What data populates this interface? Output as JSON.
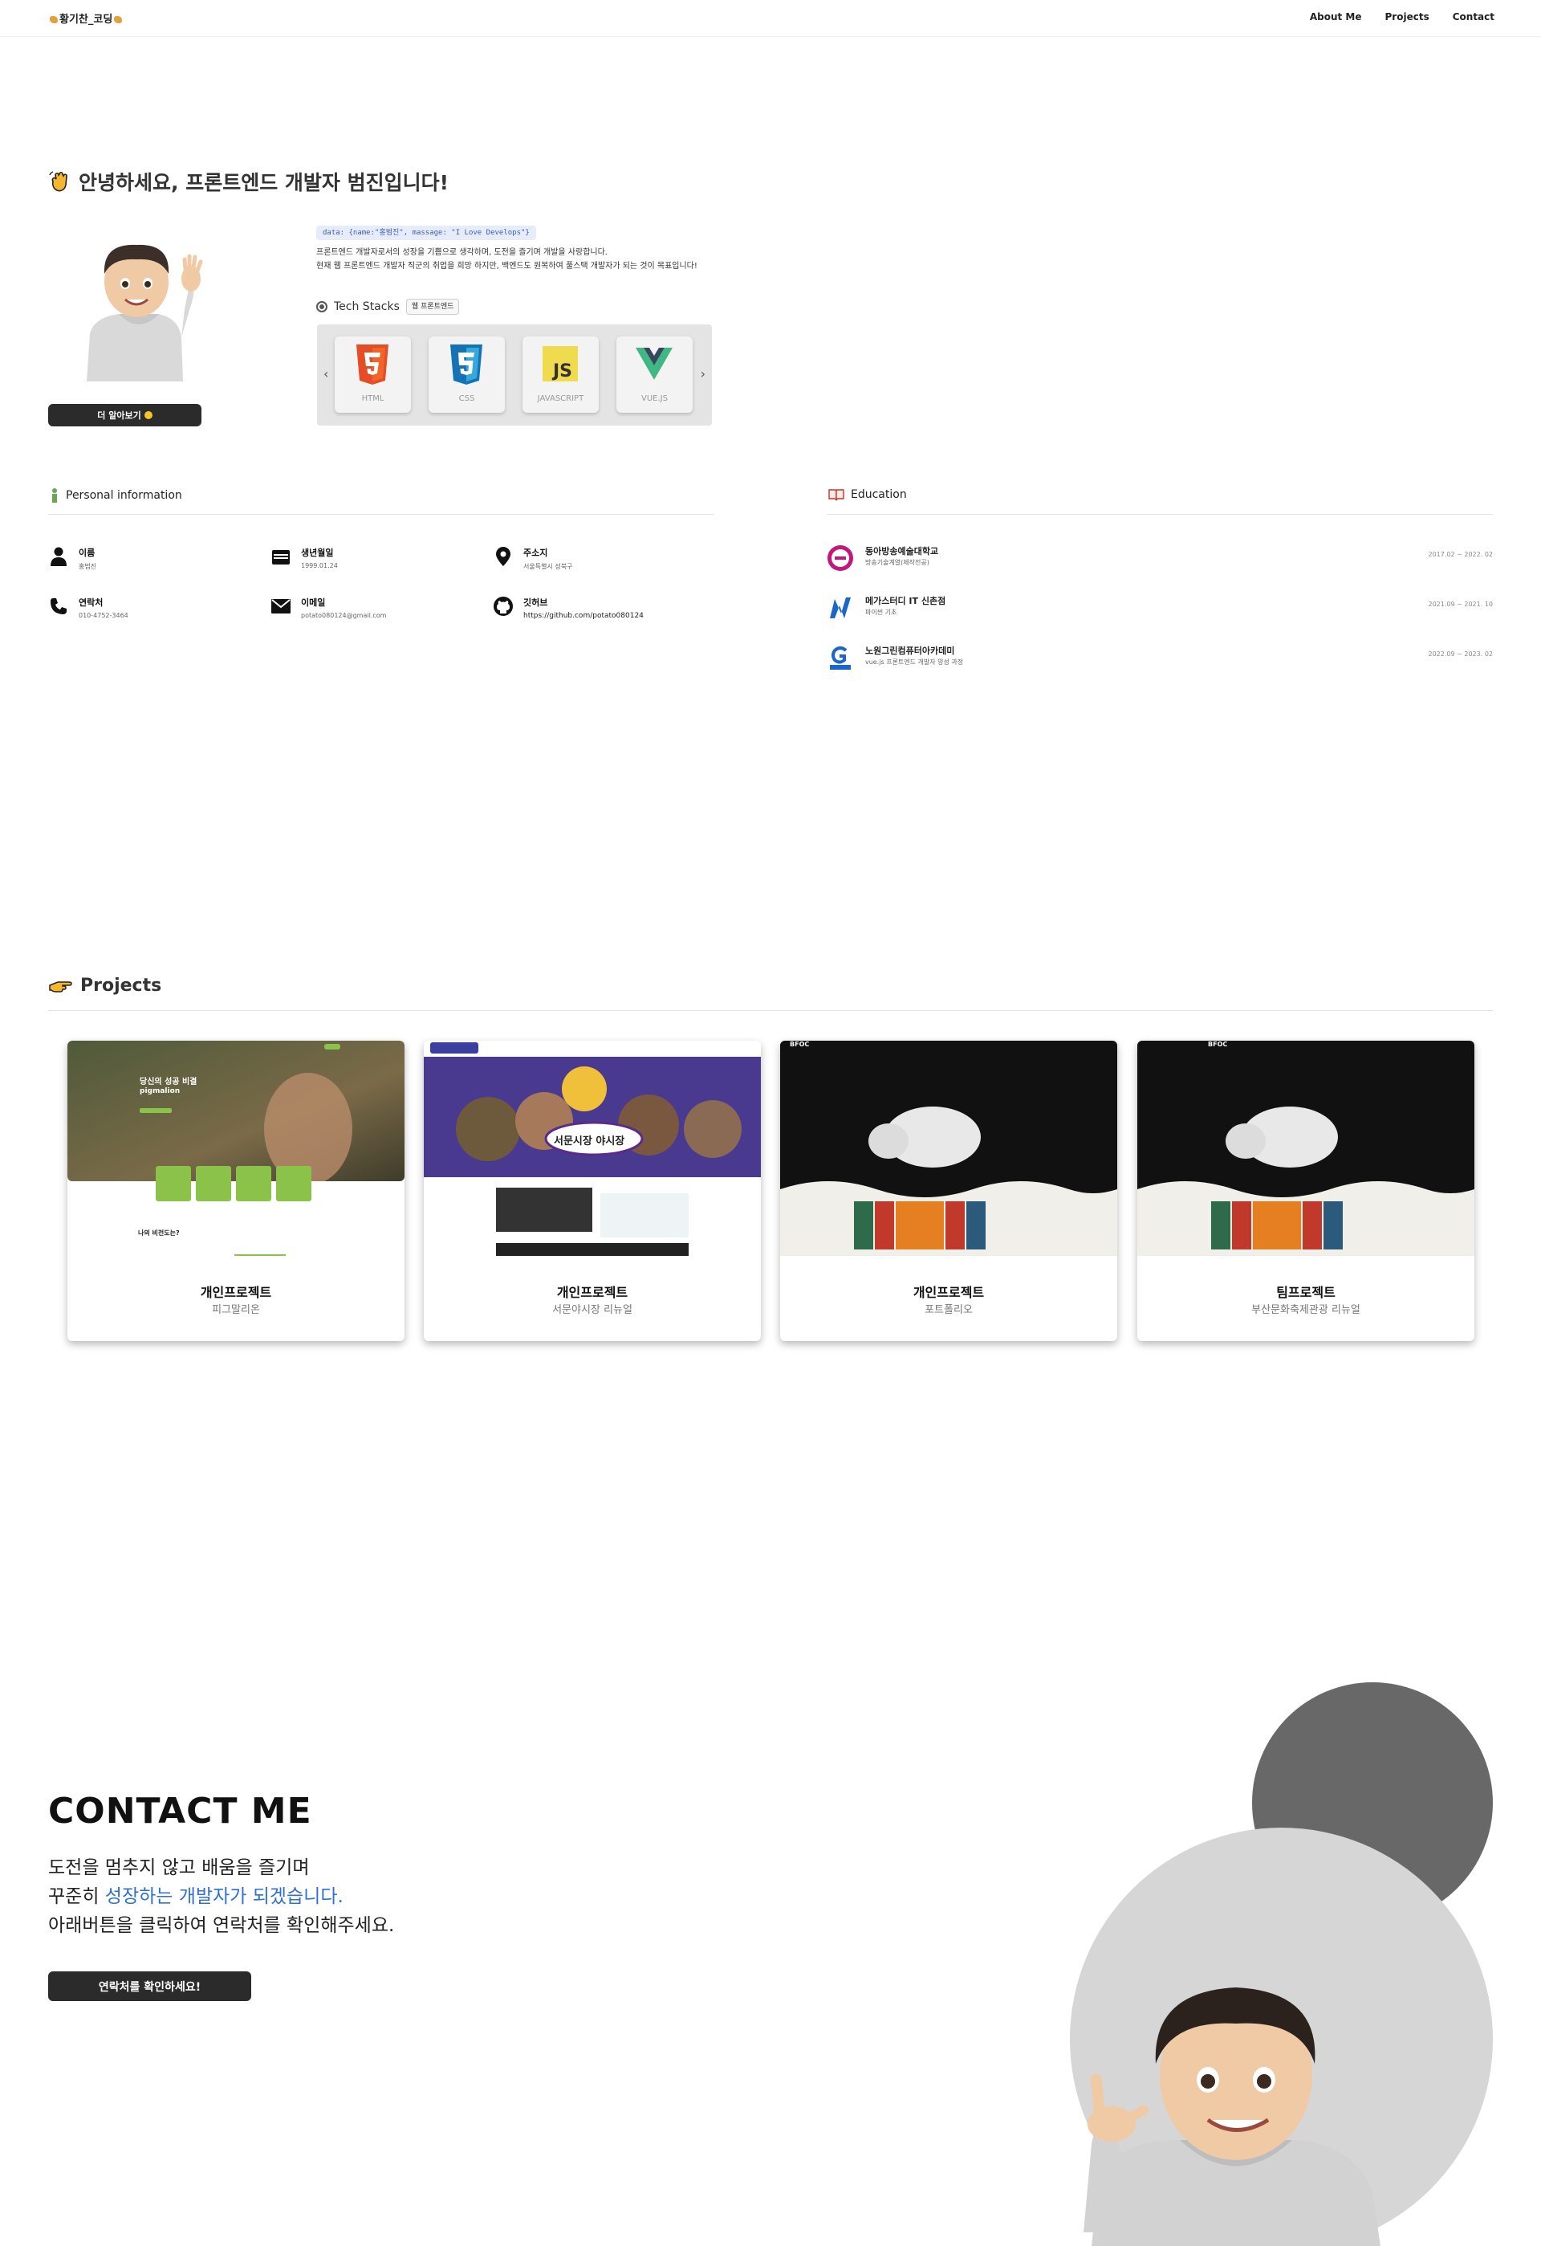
{
  "nav": {
    "logo": "황기찬_코딩",
    "links": [
      "About Me",
      "Projects",
      "Contact"
    ]
  },
  "hero": {
    "title": "안녕하세요, 프론트엔드 개발자 범진입니다!",
    "code_chip": "data: {name:\"홍범진\", massage: \"I Love Develops\"}",
    "intro_line1": "프론트엔드 개발자로서의 성장을 기쁨으로 생각하며, 도전을 즐기며 개발을 사랑합니다.",
    "intro_line2": "현재 웹 프론트엔드 개발자 직군의 취업을 희망 하지만, 백엔드도 원복하여 풀스택 개발자가 되는 것이 목표입니다!",
    "more_button": "더 알아보기",
    "tech_title": "Tech Stacks",
    "tech_badge": "웹 프론트엔드",
    "tech": [
      "HTML",
      "CSS",
      "JAVASCRIPT",
      "VUE.JS"
    ]
  },
  "personal": {
    "title": "Personal information",
    "items": [
      {
        "label": "이름",
        "value": "홍범진",
        "icon": "person-icon"
      },
      {
        "label": "생년월일",
        "value": "1999.01.24",
        "icon": "calendar-icon"
      },
      {
        "label": "주소지",
        "value": "서울특별시 성북구",
        "icon": "location-icon"
      },
      {
        "label": "연락처",
        "value": "010-4752-3464",
        "icon": "phone-icon"
      },
      {
        "label": "이메일",
        "value": "potato080124@gmail.com",
        "icon": "mail-icon"
      },
      {
        "label": "깃허브",
        "value": "https://github.com/potato080124",
        "icon": "github-icon"
      }
    ]
  },
  "education": {
    "title": "Education",
    "items": [
      {
        "name": "동아방송예술대학교",
        "sub": "방송기술계열(제작전공)",
        "date": "2017.02 ~ 2022. 02"
      },
      {
        "name": "메가스터디 IT 신촌점",
        "sub": "파이썬 기초",
        "date": "2021.09 ~ 2021. 10"
      },
      {
        "name": "노원그린컴퓨터아카데미",
        "sub": "vue.js 프론트엔드 개발자 양성 과정",
        "date": "2022.09 ~ 2023. 02"
      }
    ]
  },
  "projects": {
    "title": "Projects",
    "cards": [
      {
        "name": "개인프로젝트",
        "desc": "피그말리온"
      },
      {
        "name": "개인프로젝트",
        "desc": "서문야시장 리뉴얼"
      },
      {
        "name": "개인프로젝트",
        "desc": "포트폴리오"
      },
      {
        "name": "팀프로젝트",
        "desc": "부산문화축제관광 리뉴얼"
      }
    ],
    "thumb1": {
      "headline": "당신의 성공 비결",
      "brand": "pigmalion",
      "section": "나의 비전도는?"
    },
    "thumb2": {
      "sign": "서문시장 야시장"
    },
    "thumb3": {
      "brand": "BFOC"
    },
    "thumb4": {
      "brand": "BFOC"
    }
  },
  "contact": {
    "title": "CONTACT ME",
    "line1": "도전을 멈추지 않고 배움을 즐기며",
    "line2_prefix": "꾸준히 ",
    "line2_blue": "성장하는 개발자가 되겠습니다.",
    "line3": "아래버튼을 클릭하여 연락처를 확인해주세요.",
    "button": "연락처를 확인하세요!"
  },
  "colors": {
    "accent_blue": "#2f6fd6",
    "dark_button": "#2b2b2b",
    "circle_dark": "#686868",
    "circle_light": "#d6d6d6"
  }
}
